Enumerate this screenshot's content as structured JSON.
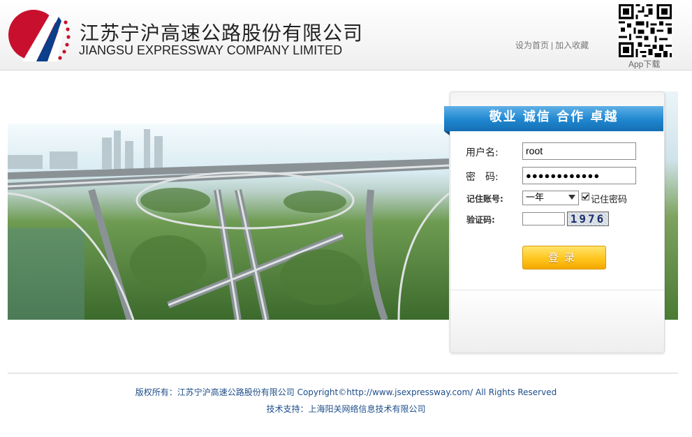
{
  "header": {
    "company_cn": "江苏宁沪高速公路股份有限公司",
    "company_en": "JIANGSU EXPRESSWAY COMPANY LIMITED",
    "link_homepage": "设为首页",
    "link_separator": "|",
    "link_favorite": "加入收藏",
    "app_download": "App下载"
  },
  "login": {
    "slogan": "敬业 诚信 合作 卓越",
    "username_label": "用户名:",
    "username_value": "root",
    "password_label": "密　码:",
    "password_value": "●●●●●●●●●●●●",
    "remember_label": "记住账号:",
    "remember_option": "一年",
    "remember_password_label": "记住密码",
    "remember_password_checked": true,
    "captcha_label": "验证码:",
    "captcha_value": "",
    "captcha_code": "1976",
    "login_button": "登录"
  },
  "footer": {
    "copyright": "版权所有：江苏宁沪高速公路股份有限公司 Copyright©http://www.jsexpressway.com/ All Rights Reserved",
    "support": "技术支持：上海阳关网络信息技术有限公司"
  },
  "colors": {
    "logo_red": "#c8102e",
    "logo_blue": "#0b3f8c",
    "ribbon_blue": "#1f86cf",
    "button_gold": "#ffc61e",
    "footer_text": "#1d4d8a"
  }
}
